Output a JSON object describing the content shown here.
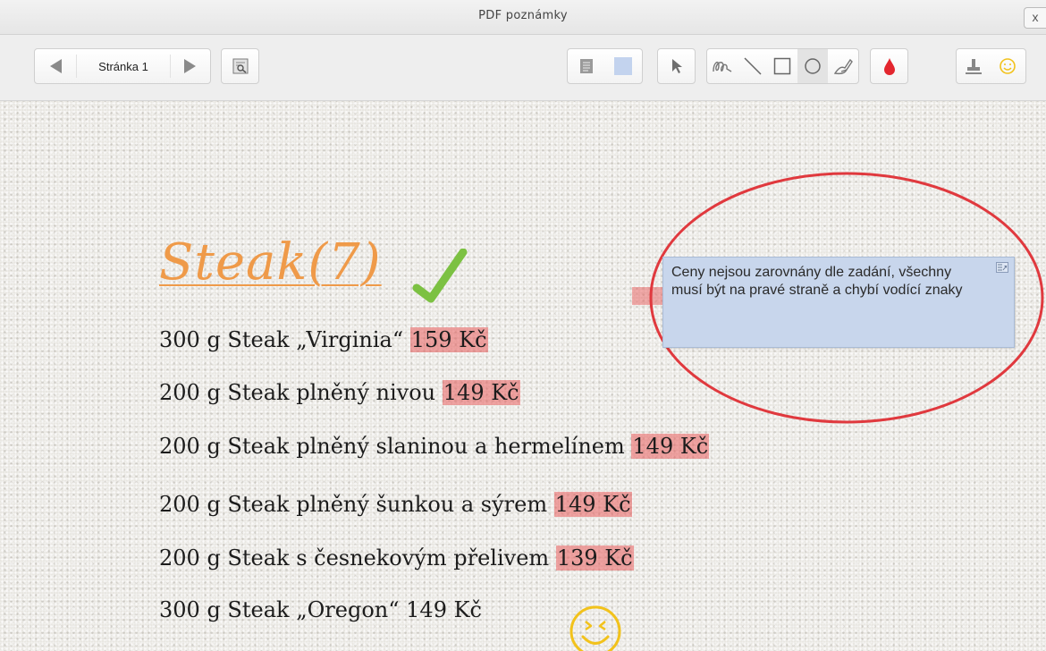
{
  "window": {
    "title": "PDF poznámky",
    "close_label": "x"
  },
  "toolbar": {
    "page_label": "Stránka 1",
    "tools": [
      {
        "icon": "prev-page-icon"
      },
      {
        "icon": "next-page-icon"
      },
      {
        "icon": "search-page-icon"
      },
      {
        "icon": "note-icon"
      },
      {
        "icon": "highlight-color-icon",
        "color": "#c3d3ee"
      },
      {
        "icon": "pointer-icon"
      },
      {
        "icon": "freehand-icon"
      },
      {
        "icon": "line-icon"
      },
      {
        "icon": "rectangle-icon"
      },
      {
        "icon": "ellipse-icon"
      },
      {
        "icon": "eraser-icon"
      },
      {
        "icon": "color-drop-icon",
        "color": "#e3262e"
      },
      {
        "icon": "stamp-icon"
      },
      {
        "icon": "smiley-icon",
        "color": "#f2c21b"
      }
    ]
  },
  "document": {
    "heading": "Steak(7)",
    "items": [
      {
        "text": "300 g Steak „Virginia“ ",
        "price": "159 Kč",
        "highlighted": true
      },
      {
        "text": "200 g Steak plněný nivou ",
        "price": "149 Kč",
        "highlighted": true
      },
      {
        "text": "200 g Steak plněný slaninou a hermelínem ",
        "price": "149 Kč",
        "highlighted": true
      },
      {
        "text": "200 g Steak plněný šunkou a sýrem ",
        "price": "149 Kč",
        "highlighted": true
      },
      {
        "text": "200 g Steak s česnekovým přelivem ",
        "price": "139 Kč",
        "highlighted": true
      },
      {
        "text": "300 g Steak „Oregon“ 149 Kč",
        "price": "",
        "highlighted": false
      }
    ],
    "annotations": {
      "note_text": "Ceny nejsou zarovnány dle zadání, všechny musí být na pravé straně a chybí vodící znaky",
      "checkmark_color": "#7cc142",
      "ellipse_color": "#e0393e",
      "highlight_color": "#e85c5c",
      "smiley_color": "#f2c21b"
    }
  }
}
